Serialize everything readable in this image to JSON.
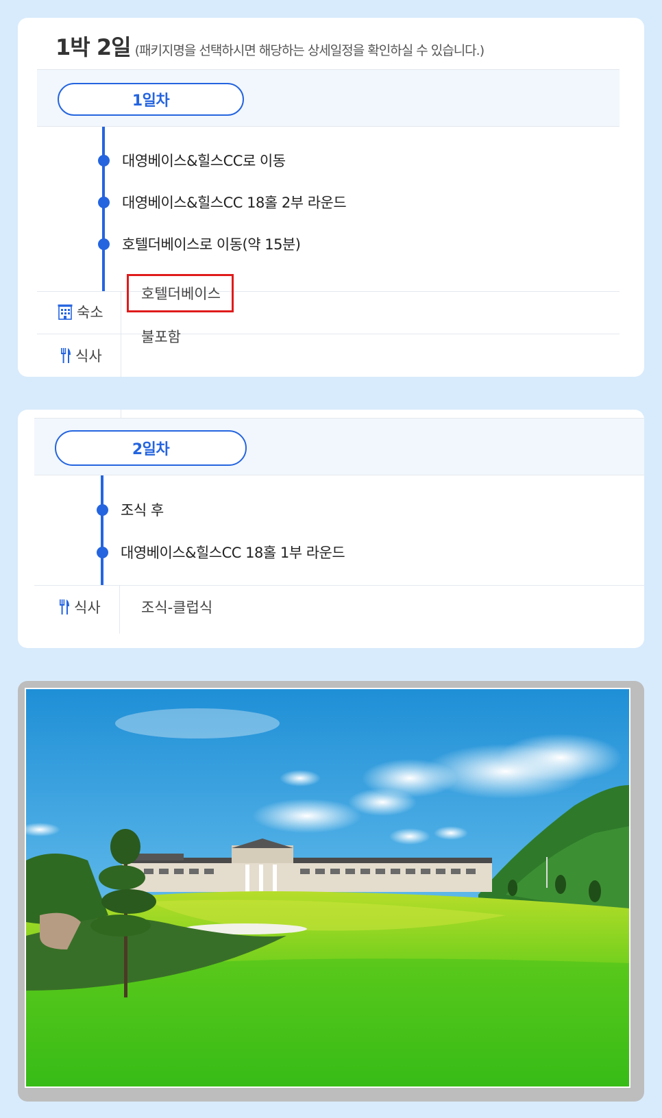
{
  "header": {
    "title": "1박 2일",
    "subtitle": "(패키지명을 선택하시면 해당하는 상세일정을 확인하실 수 있습니다.)"
  },
  "days": [
    {
      "label": "1일차",
      "items": [
        "대영베이스&힐스CC로 이동",
        "대영베이스&힐스CC 18홀 2부 라운드",
        "호텔더베이스로 이동(약 15분)"
      ],
      "lodging_label": "숙소",
      "lodging_value": "호텔더베이스",
      "meal_label": "식사",
      "meal_value": "불포함"
    },
    {
      "label": "2일차",
      "items": [
        "조식 후",
        "대영베이스&힐스CC 18홀 1부 라운드"
      ],
      "meal_label": "식사",
      "meal_value": "조식-클럽식"
    }
  ],
  "icons": {
    "lodging": "building-icon",
    "meal": "fork-knife-icon"
  },
  "colors": {
    "accent": "#2464df",
    "highlight": "#e01b1b",
    "page_bg": "#d8ebfc",
    "band_bg": "#f1f7fd"
  }
}
